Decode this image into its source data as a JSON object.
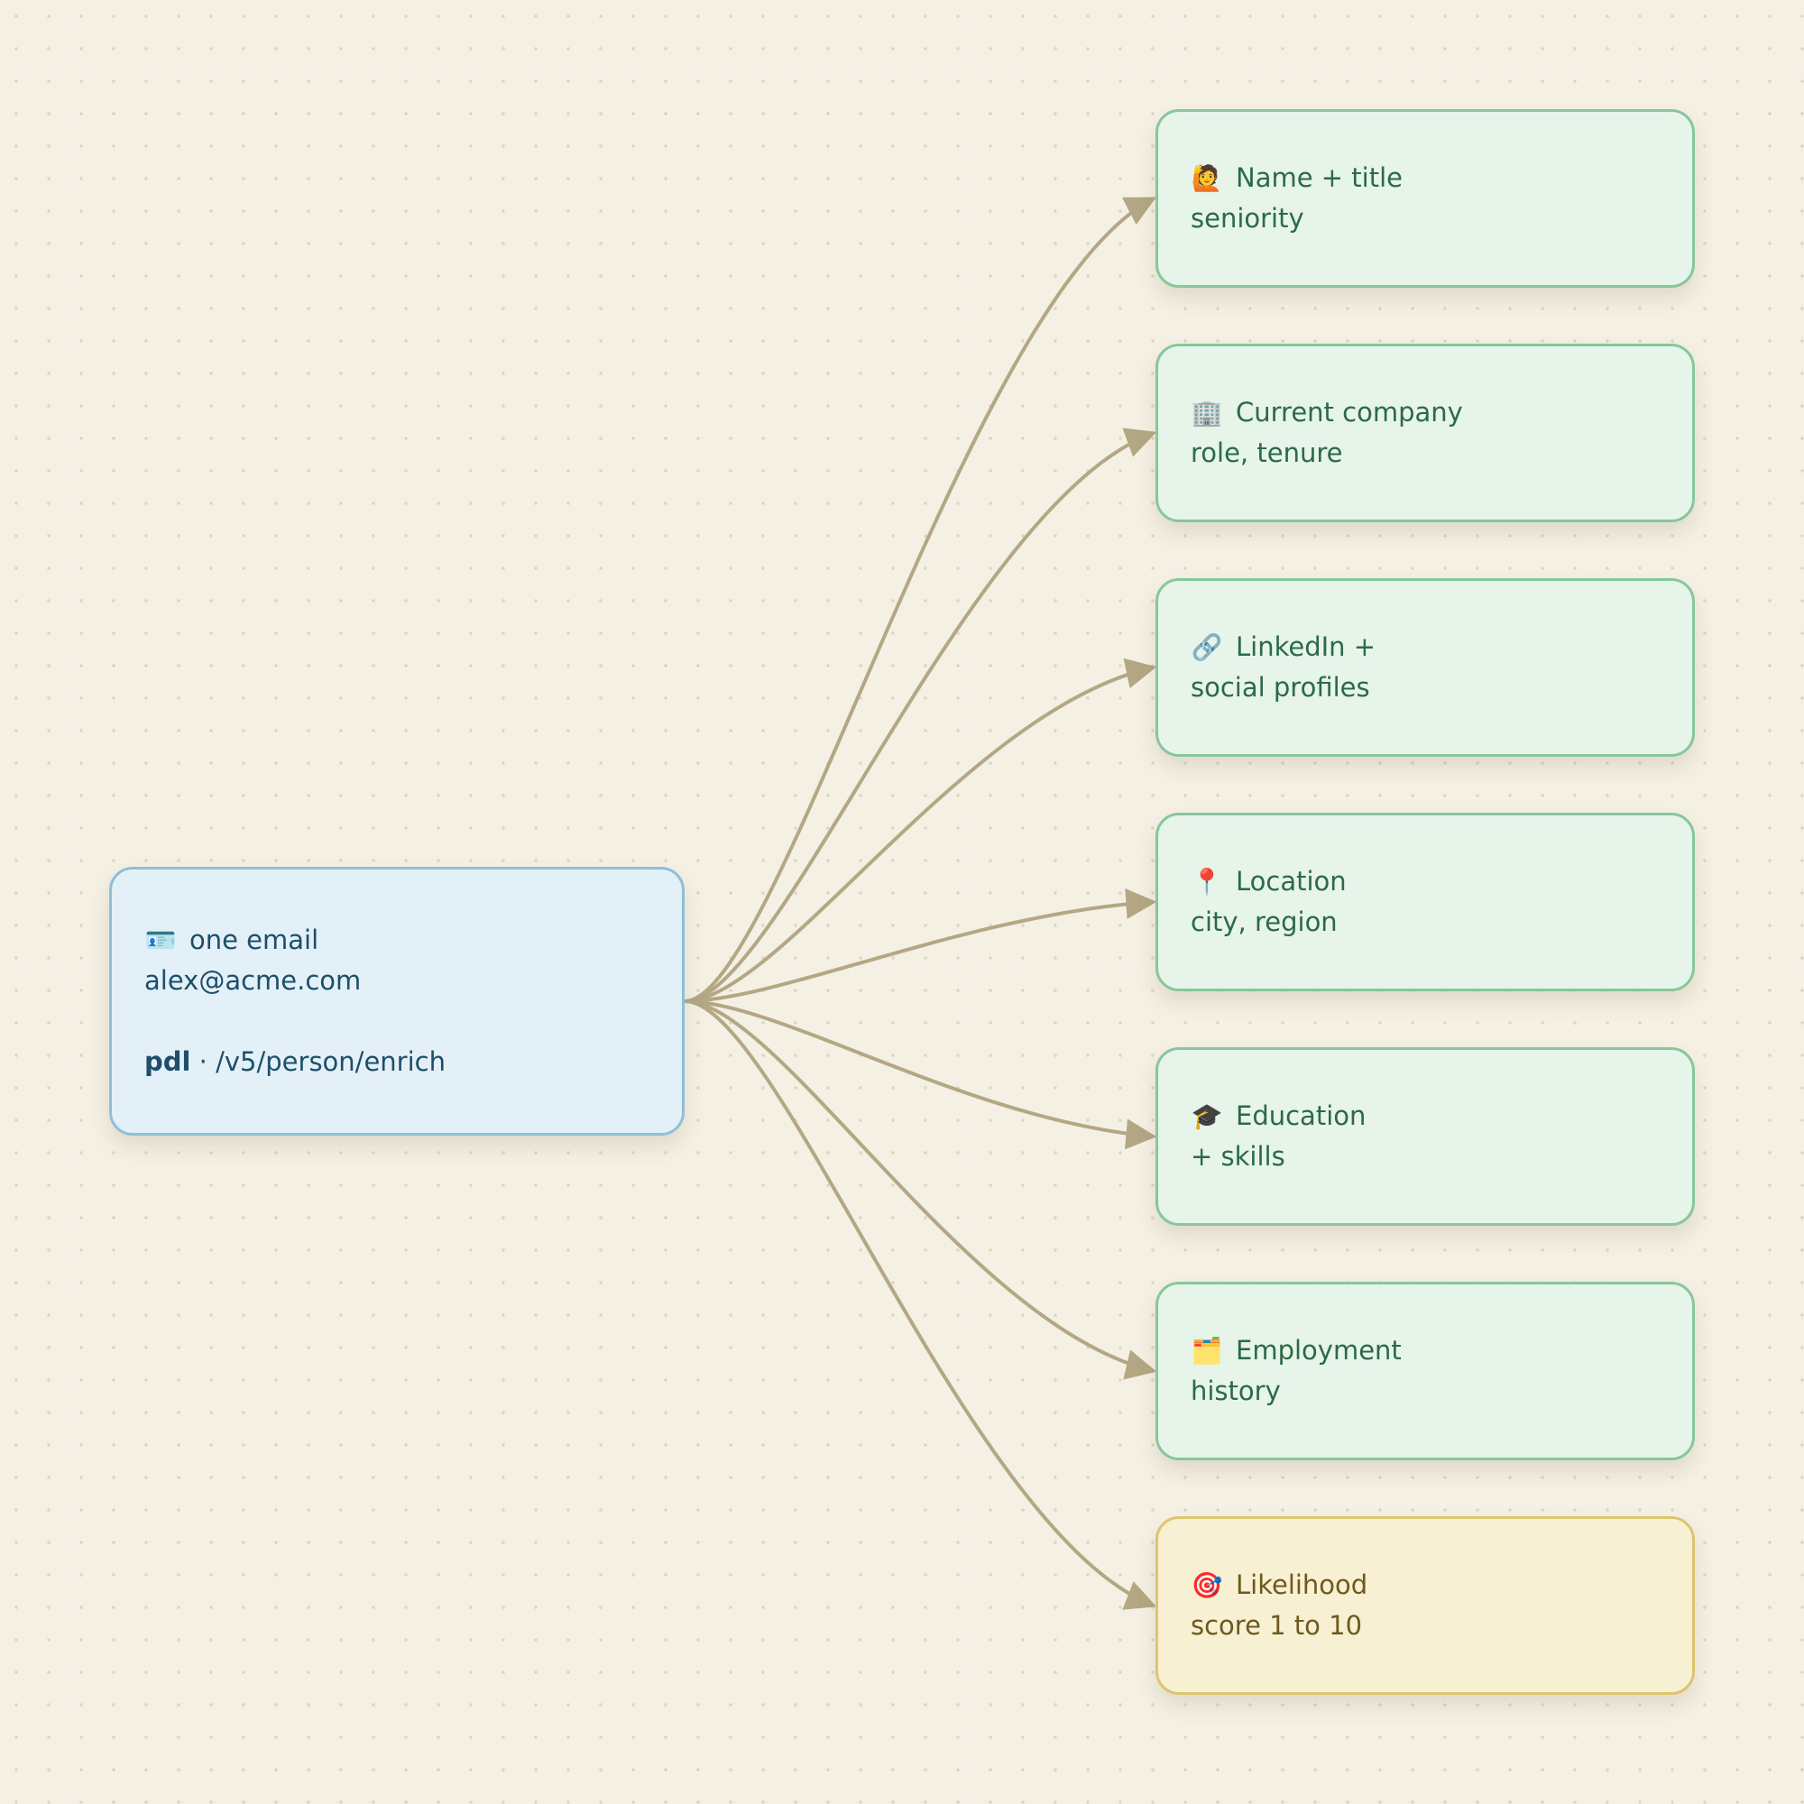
{
  "colors": {
    "edge": "#b3a784",
    "source_fill": "#e3f0f7",
    "source_border": "#8fbfd9",
    "target_fill": "#e6f4ea",
    "target_border": "#86c79b",
    "score_fill": "#f8f0d2",
    "score_border": "#dcc56f"
  },
  "source": {
    "icon": "id-card-icon",
    "icon_glyph": "🪪",
    "title": "one email",
    "email": "alex@acme.com",
    "brand": "pdl",
    "separator": " · ",
    "endpoint": "/v5/person/enrich"
  },
  "targets": [
    {
      "icon": "person-raising-hand-icon",
      "icon_glyph": "🙋",
      "title": "Name + title",
      "subtitle": "seniority"
    },
    {
      "icon": "office-building-icon",
      "icon_glyph": "🏢",
      "title": "Current company",
      "subtitle": "role, tenure"
    },
    {
      "icon": "link-icon",
      "icon_glyph": "🔗",
      "title": "LinkedIn +",
      "subtitle": "social profiles"
    },
    {
      "icon": "map-pin-icon",
      "icon_glyph": "📍",
      "title": "Location",
      "subtitle": "city, region"
    },
    {
      "icon": "graduation-cap-icon",
      "icon_glyph": "🎓",
      "title": "Education",
      "subtitle": "+ skills"
    },
    {
      "icon": "card-index-dividers-icon",
      "icon_glyph": "🗂️",
      "title": "Employment",
      "subtitle": "history"
    },
    {
      "icon": "target-icon",
      "icon_glyph": "🎯",
      "title": "Likelihood",
      "subtitle": "score 1 to 10"
    }
  ]
}
